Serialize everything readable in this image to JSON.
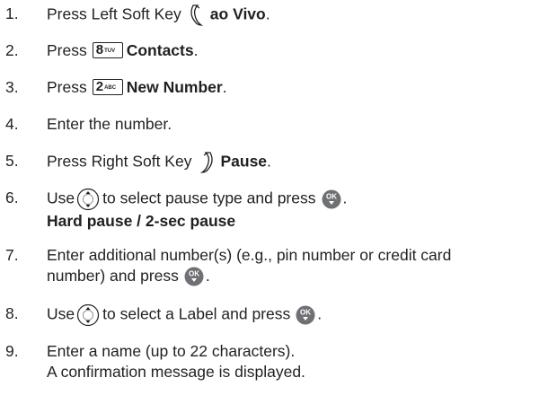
{
  "steps": [
    {
      "number": "1.",
      "lines": [
        {
          "pre": "Press Left Soft Key",
          "post": "ao Vivo",
          "tail": "."
        }
      ]
    },
    {
      "number": "2.",
      "lines": [
        {
          "pre": "Press",
          "key_main": "8",
          "key_sub": "TUV",
          "post": "Contacts",
          "tail": "."
        }
      ]
    },
    {
      "number": "3.",
      "lines": [
        {
          "pre": "Press",
          "key_main": "2",
          "key_sub": "ABC",
          "post": "New Number",
          "tail": "."
        }
      ]
    },
    {
      "number": "4.",
      "lines": [
        {
          "text": "Enter the number."
        }
      ]
    },
    {
      "number": "5.",
      "lines": [
        {
          "pre": "Press Right Soft Key",
          "post": "Pause",
          "tail": "."
        }
      ]
    },
    {
      "number": "6.",
      "lines": [
        {
          "pre": "Use",
          "mid": "to select pause type and press",
          "tail": "."
        },
        {
          "bold": "Hard pause / 2-sec pause"
        }
      ]
    },
    {
      "number": "7.",
      "lines": [
        {
          "text": "Enter additional number(s) (e.g., pin number or credit card"
        },
        {
          "pre": "number) and press",
          "tail": "."
        }
      ]
    },
    {
      "number": "8.",
      "lines": [
        {
          "pre": "Use",
          "mid": "to select a Label and press",
          "tail": "."
        }
      ]
    },
    {
      "number": "9.",
      "lines": [
        {
          "text": "Enter a name (up to 22 characters)."
        },
        {
          "text": "A confirmation message is displayed."
        }
      ]
    }
  ],
  "icons": {
    "left_soft_key": "left-soft-key-icon",
    "right_soft_key": "right-soft-key-icon",
    "nav_key": "directional-key-icon",
    "ok_key": "ok-key-icon",
    "ok_key_label": "OK"
  },
  "colors": {
    "text": "#231f20",
    "ok_key": "#6f7073"
  }
}
